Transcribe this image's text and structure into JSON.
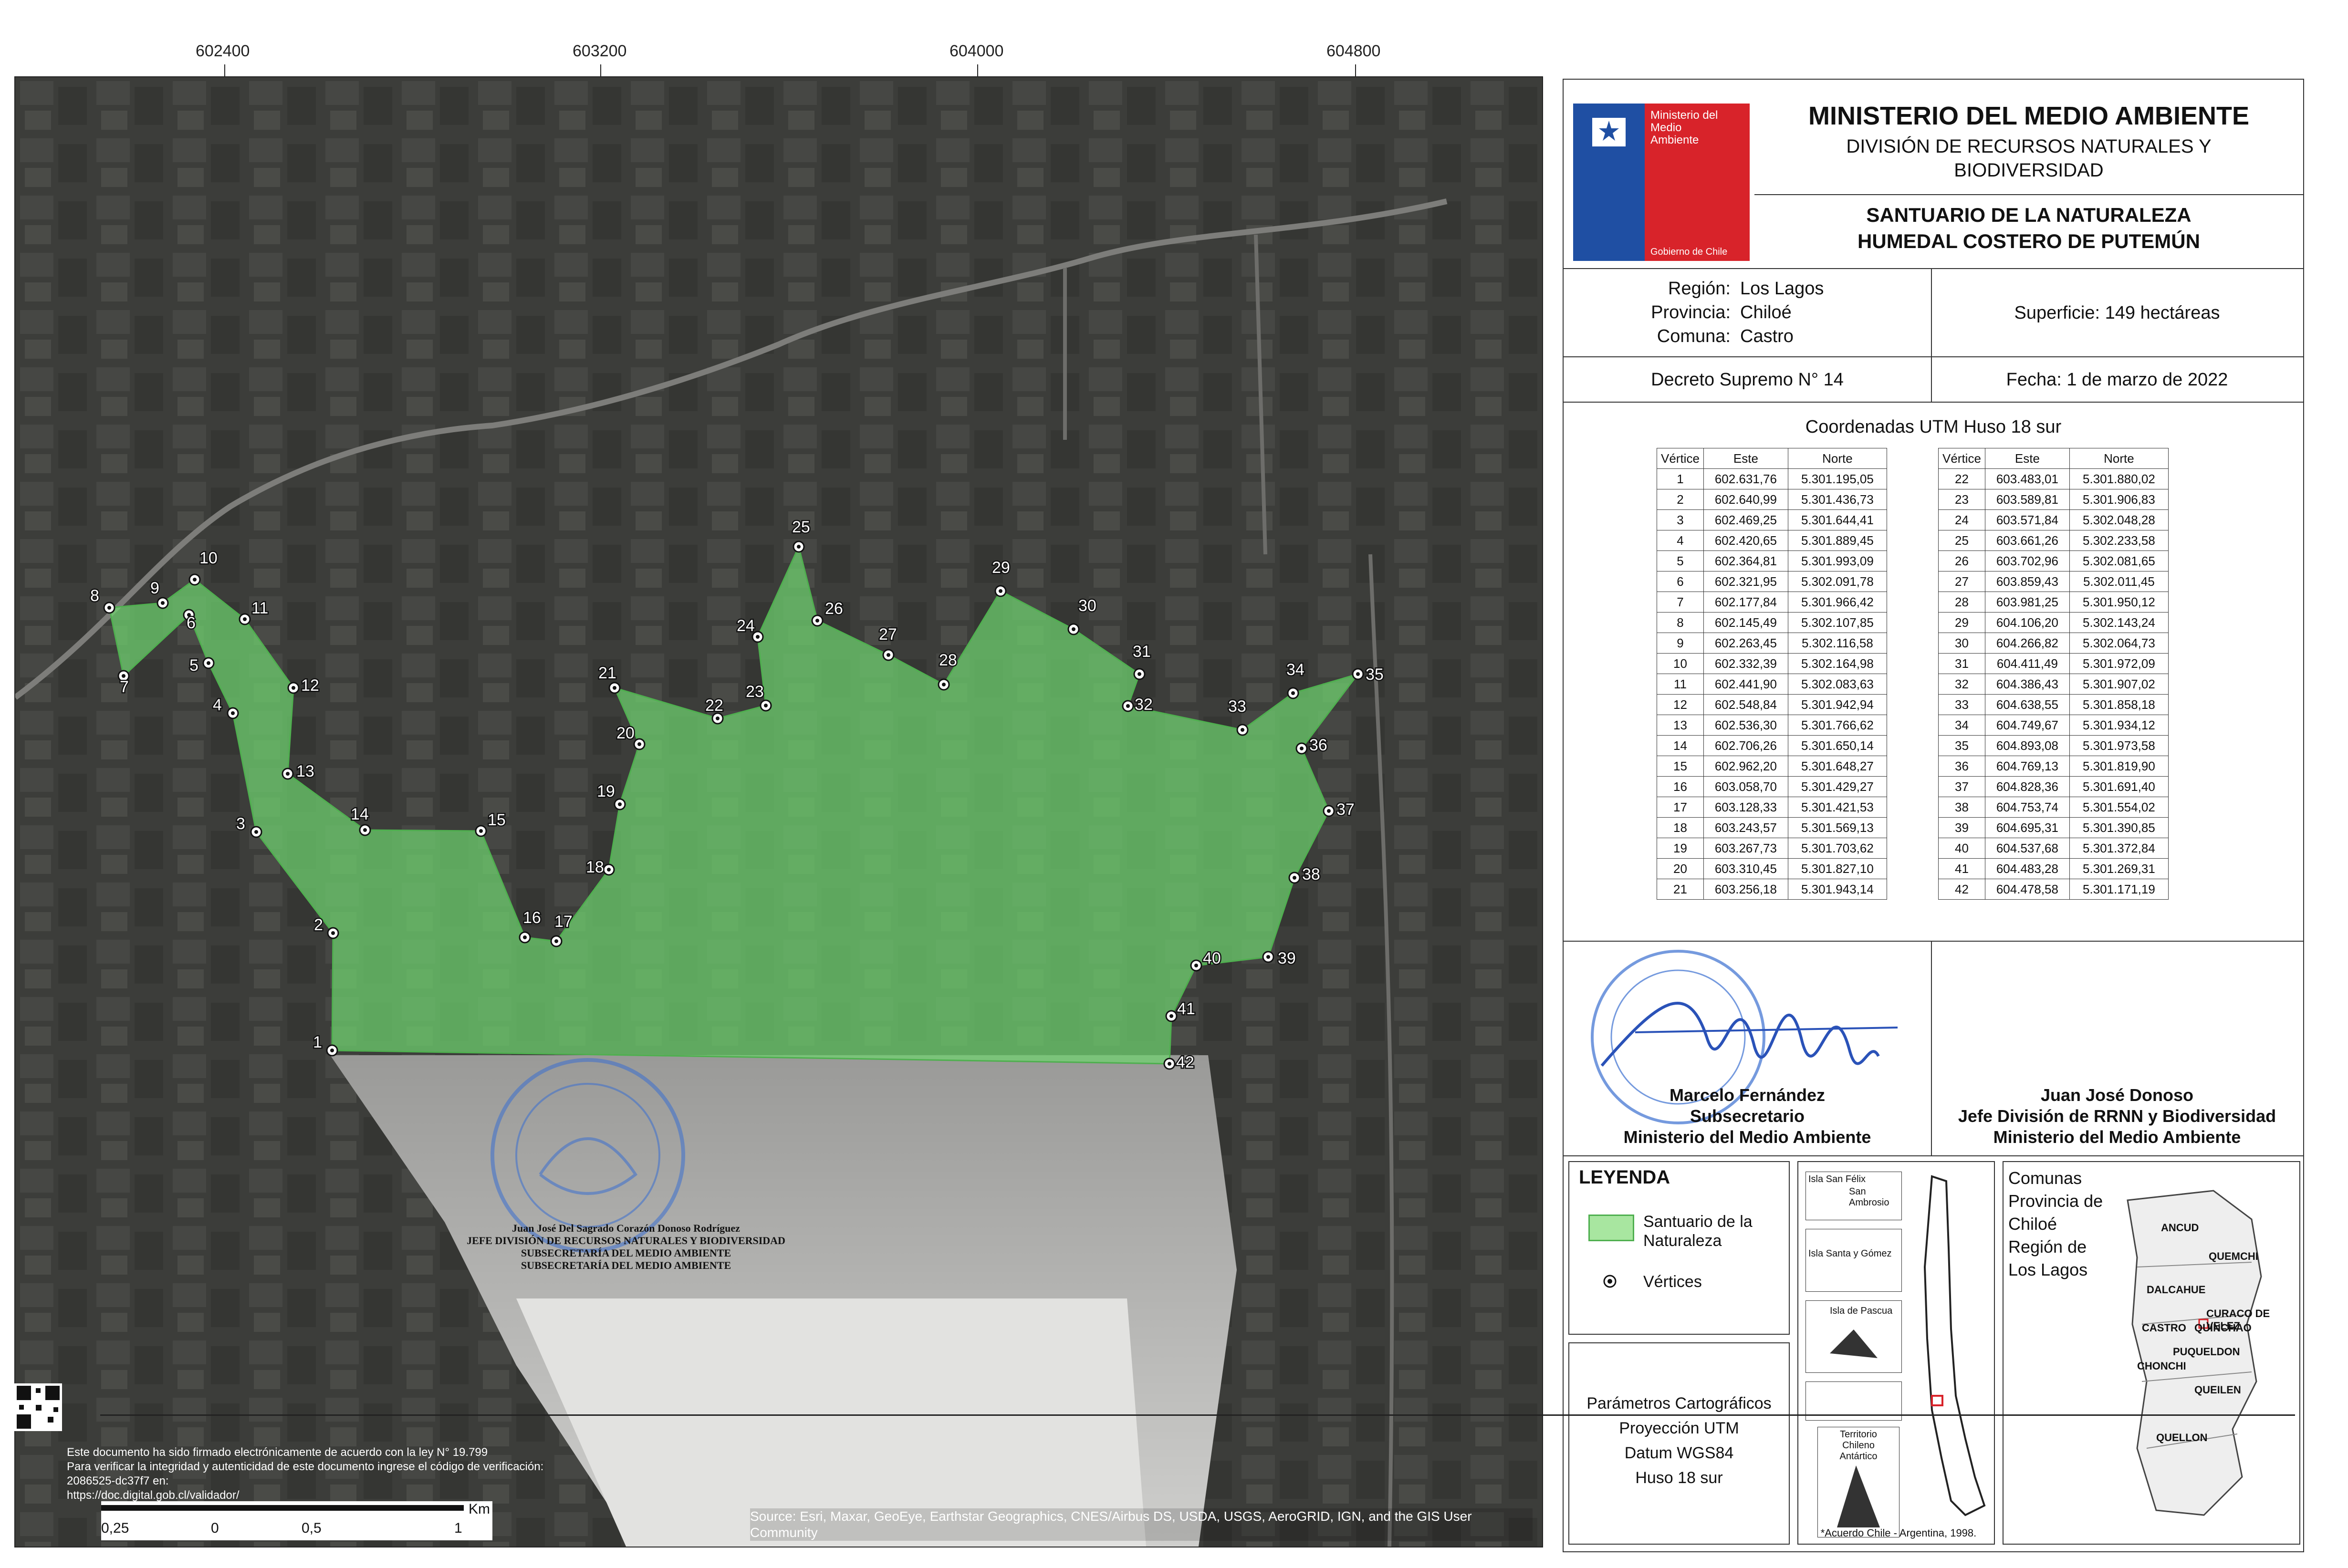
{
  "coord_ticks": {
    "x": [
      "602400",
      "603200",
      "604000",
      "604800"
    ]
  },
  "map": {
    "source": "Source: Esri, Maxar, GeoEye, Earthstar Geographics, CNES/Airbus DS, USDA, USGS, AeroGRID, IGN, and the GIS User Community",
    "scale_unit": "Km",
    "scale_labels": [
      "0,25",
      "0",
      "0,5",
      "1"
    ],
    "stamp_lines": [
      "Juan José Del Sagrado Corazón Donoso Rodríguez",
      "JEFE DIVISIÓN DE RECURSOS NATURALES Y BIODIVERSIDAD",
      "SUBSECRETARÍA DEL MEDIO AMBIENTE",
      "SUBSECRETARÍA DEL MEDIO AMBIENTE"
    ],
    "e_sign_lines": [
      "Este documento ha sido firmado electrónicamente de acuerdo con la ley N° 19.799",
      "Para verificar la integridad y autenticidad de este documento ingrese el código de verificación: 2086525-dc37f7 en:",
      "https://doc.digital.gob.cl/validador/"
    ],
    "polygon_color": "#6fd36f",
    "vertex_labels": [
      "1",
      "2",
      "3",
      "4",
      "5",
      "6",
      "7",
      "8",
      "9",
      "10",
      "11",
      "12",
      "13",
      "14",
      "15",
      "16",
      "17",
      "18",
      "19",
      "20",
      "21",
      "22",
      "23",
      "24",
      "25",
      "26",
      "27",
      "28",
      "29",
      "30",
      "31",
      "32",
      "33",
      "34",
      "35",
      "36",
      "37",
      "38",
      "39",
      "40",
      "41",
      "42"
    ]
  },
  "header": {
    "logo_text": [
      "Ministerio del",
      "Medio",
      "Ambiente"
    ],
    "logo_footer": "Gobierno de Chile",
    "ministry": "MINISTERIO DEL MEDIO AMBIENTE",
    "division": "DIVISIÓN DE RECURSOS NATURALES Y BIODIVERSIDAD",
    "title_line1": "SANTUARIO DE LA NATURALEZA",
    "title_line2": "HUMEDAL COSTERO DE PUTEMÚN"
  },
  "info": {
    "region_label": "Región:",
    "region": "Los Lagos",
    "provincia_label": "Provincia:",
    "provincia": "Chiloé",
    "comuna_label": "Comuna:",
    "comuna": "Castro",
    "superficie": "Superficie: 149  hectáreas",
    "decreto": "Decreto Supremo N° 14",
    "fecha": "Fecha: 1 de marzo de 2022"
  },
  "coords": {
    "title": "Coordenadas UTM Huso 18 sur",
    "headers": [
      "Vértice",
      "Este",
      "Norte"
    ],
    "left": [
      [
        "1",
        "602.631,76",
        "5.301.195,05"
      ],
      [
        "2",
        "602.640,99",
        "5.301.436,73"
      ],
      [
        "3",
        "602.469,25",
        "5.301.644,41"
      ],
      [
        "4",
        "602.420,65",
        "5.301.889,45"
      ],
      [
        "5",
        "602.364,81",
        "5.301.993,09"
      ],
      [
        "6",
        "602.321,95",
        "5.302.091,78"
      ],
      [
        "7",
        "602.177,84",
        "5.301.966,42"
      ],
      [
        "8",
        "602.145,49",
        "5.302.107,85"
      ],
      [
        "9",
        "602.263,45",
        "5.302.116,58"
      ],
      [
        "10",
        "602.332,39",
        "5.302.164,98"
      ],
      [
        "11",
        "602.441,90",
        "5.302.083,63"
      ],
      [
        "12",
        "602.548,84",
        "5.301.942,94"
      ],
      [
        "13",
        "602.536,30",
        "5.301.766,62"
      ],
      [
        "14",
        "602.706,26",
        "5.301.650,14"
      ],
      [
        "15",
        "602.962,20",
        "5.301.648,27"
      ],
      [
        "16",
        "603.058,70",
        "5.301.429,27"
      ],
      [
        "17",
        "603.128,33",
        "5.301.421,53"
      ],
      [
        "18",
        "603.243,57",
        "5.301.569,13"
      ],
      [
        "19",
        "603.267,73",
        "5.301.703,62"
      ],
      [
        "20",
        "603.310,45",
        "5.301.827,10"
      ],
      [
        "21",
        "603.256,18",
        "5.301.943,14"
      ]
    ],
    "right": [
      [
        "22",
        "603.483,01",
        "5.301.880,02"
      ],
      [
        "23",
        "603.589,81",
        "5.301.906,83"
      ],
      [
        "24",
        "603.571,84",
        "5.302.048,28"
      ],
      [
        "25",
        "603.661,26",
        "5.302.233,58"
      ],
      [
        "26",
        "603.702,96",
        "5.302.081,65"
      ],
      [
        "27",
        "603.859,43",
        "5.302.011,45"
      ],
      [
        "28",
        "603.981,25",
        "5.301.950,12"
      ],
      [
        "29",
        "604.106,20",
        "5.302.143,24"
      ],
      [
        "30",
        "604.266,82",
        "5.302.064,73"
      ],
      [
        "31",
        "604.411,49",
        "5.301.972,09"
      ],
      [
        "32",
        "604.386,43",
        "5.301.907,02"
      ],
      [
        "33",
        "604.638,55",
        "5.301.858,18"
      ],
      [
        "34",
        "604.749,67",
        "5.301.934,12"
      ],
      [
        "35",
        "604.893,08",
        "5.301.973,58"
      ],
      [
        "36",
        "604.769,13",
        "5.301.819,90"
      ],
      [
        "37",
        "604.828,36",
        "5.301.691,40"
      ],
      [
        "38",
        "604.753,74",
        "5.301.554,02"
      ],
      [
        "39",
        "604.695,31",
        "5.301.390,85"
      ],
      [
        "40",
        "604.537,68",
        "5.301.372,84"
      ],
      [
        "41",
        "604.483,28",
        "5.301.269,31"
      ],
      [
        "42",
        "604.478,58",
        "5.301.171,19"
      ]
    ]
  },
  "signatures": {
    "left": {
      "name": "Marcelo Fernández",
      "role": "Subsecretario",
      "org": "Ministerio del Medio Ambiente",
      "seal": "DEL MEDIO AMBIENTE"
    },
    "right": {
      "name": "Juan José Donoso",
      "role": "Jefe División de RRNN y Biodiversidad",
      "org": "Ministerio del Medio Ambiente"
    }
  },
  "legend": {
    "title": "LEYENDA",
    "item1": "Santuario de la Naturaleza",
    "item2": "Vértices"
  },
  "params": {
    "title": "Parámetros Cartográficos",
    "lines": [
      "Proyección UTM",
      "Datum WGS84",
      "Huso 18 sur"
    ]
  },
  "inset_chile": {
    "islands": [
      "Isla San Félix",
      "San Ambrosio",
      "Isla Santa y Gómez",
      "Isla de Pascua"
    ],
    "antarctic": "Territorio Chileno Antártico",
    "note": "*Acuerdo Chile - Argentina, 1998."
  },
  "inset_chiloe": {
    "title": "Comunas Provincia de Chiloé Región de Los Lagos",
    "comunas": [
      "ANCUD",
      "QUEMCHI",
      "DALCAHUE",
      "CURACO DE VELEZ",
      "CASTRO",
      "QUINCHAO",
      "PUQUELDON",
      "CHONCHI",
      "QUEILEN",
      "QUELLON"
    ]
  }
}
